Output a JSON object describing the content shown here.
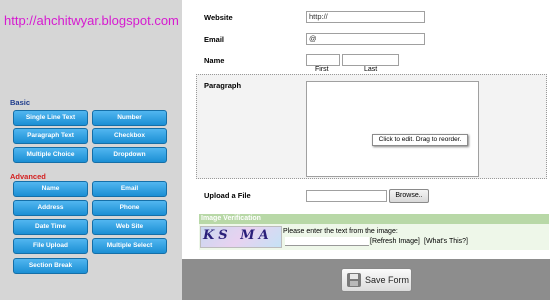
{
  "watermark": "http://ahchitwyar.blogspot.com",
  "palette": {
    "basic_title": "Basic",
    "basic_buttons": [
      "Single Line Text",
      "Number",
      "Paragraph Text",
      "Checkbox",
      "Multiple Choice",
      "Dropdown"
    ],
    "advanced_title": "Advanced",
    "advanced_buttons": [
      "Name",
      "Email",
      "Address",
      "Phone",
      "Date Time",
      "Web Site",
      "File Upload",
      "Multiple Select",
      "Section Break"
    ]
  },
  "form": {
    "website_label": "Website",
    "website_value": "http://",
    "email_label": "Email",
    "email_value": "@",
    "name_label": "Name",
    "name_first": "First",
    "name_last": "Last",
    "paragraph_label": "Paragraph",
    "tooltip": "Click to edit. Drag to reorder.",
    "upload_label": "Upload a File",
    "browse_label": "Browse..",
    "verification": {
      "heading": "Image Verification",
      "captcha_text": "KS MA",
      "prompt": "Please enter the text from the image:",
      "refresh": "[Refresh Image]",
      "whats_this": "[What's This?]"
    }
  },
  "footer": {
    "save_label": "Save Form",
    "save_icon": "save-disk-icon"
  },
  "colors": {
    "button_blue": "#2a9de0",
    "basic_title": "#1f3c8c",
    "advanced_title": "#d42020",
    "watermark": "#d61bd0",
    "verification_header": "#b8d8a7"
  }
}
